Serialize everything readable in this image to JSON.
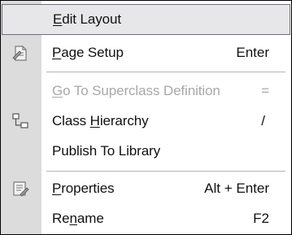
{
  "menu": {
    "items": [
      {
        "label_pre": "",
        "label_ul": "E",
        "label_post": "dit Layout",
        "shortcut": "",
        "icon": ""
      },
      {
        "label_pre": "",
        "label_ul": "P",
        "label_post": "age Setup",
        "shortcut": "Enter",
        "icon": "page-setup-icon"
      },
      {
        "label_pre": "",
        "label_ul": "G",
        "label_post": "o To Superclass Definition",
        "shortcut": "=",
        "icon": ""
      },
      {
        "label_pre": "Class ",
        "label_ul": "H",
        "label_post": "ierarchy",
        "shortcut": "/",
        "icon": "class-hierarchy-icon"
      },
      {
        "label_pre": "Publish To Library",
        "label_ul": "",
        "label_post": "",
        "shortcut": "",
        "icon": ""
      },
      {
        "label_pre": "",
        "label_ul": "P",
        "label_post": "roperties",
        "shortcut": "Alt + Enter",
        "icon": "properties-icon"
      },
      {
        "label_pre": "Re",
        "label_ul": "n",
        "label_post": "ame",
        "shortcut": "F2",
        "icon": ""
      }
    ]
  },
  "colors": {
    "gutter": "#dcdcdc",
    "highlight": "#e7e7ea",
    "disabled_text": "#a8a8a8"
  }
}
